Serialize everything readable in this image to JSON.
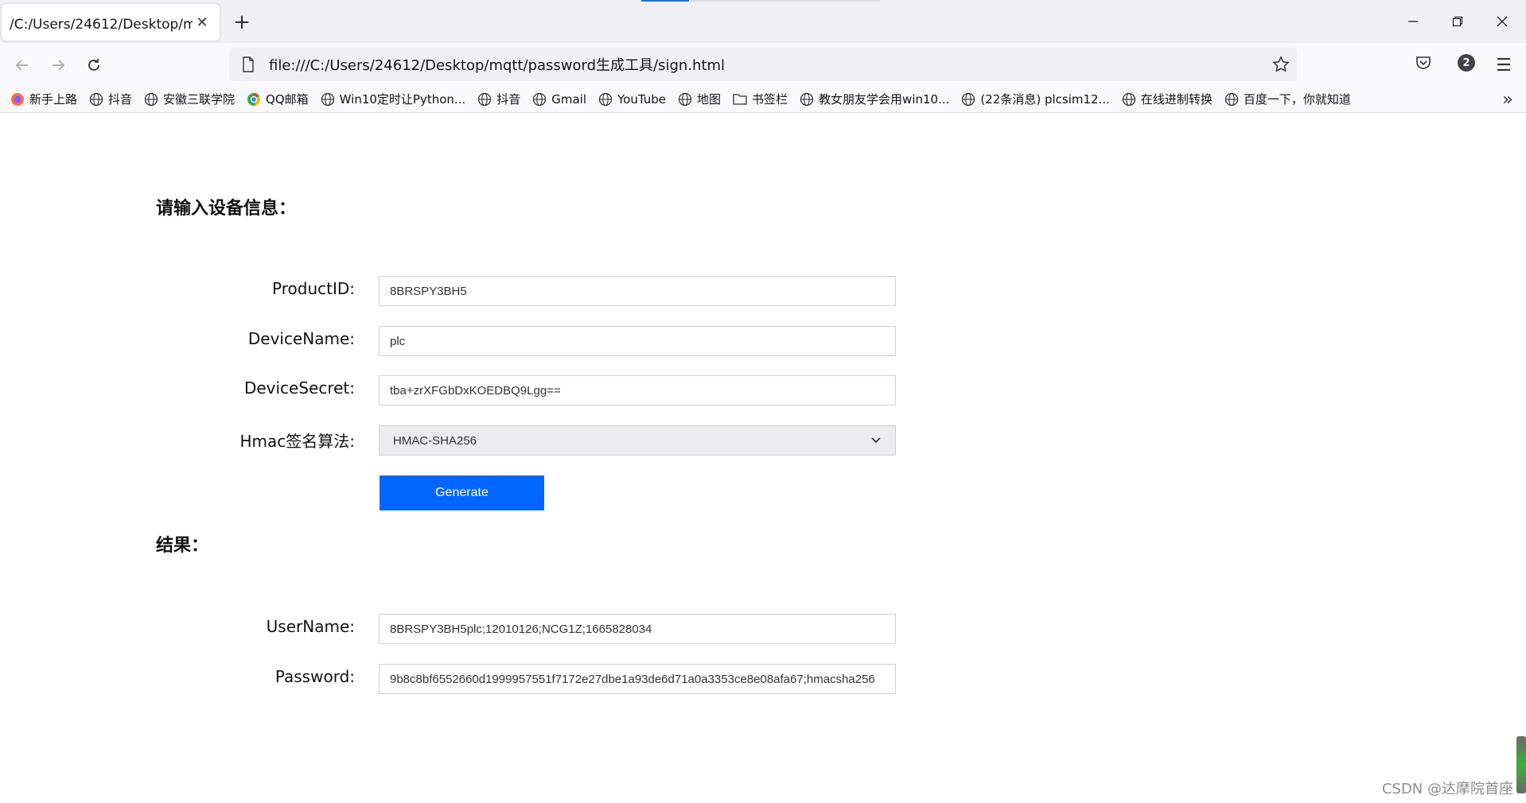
{
  "browser": {
    "tab_title": "/C:/Users/24612/Desktop/mqtt/password生成工具/sign.html",
    "url": "file:///C:/Users/24612/Desktop/mqtt/password生成工具/sign.html",
    "notification_count": "2",
    "bookmarks": [
      {
        "label": "新手上路",
        "icon": "firefox-icon"
      },
      {
        "label": "抖音",
        "icon": "globe-icon"
      },
      {
        "label": "安徽三联学院",
        "icon": "globe-icon"
      },
      {
        "label": "QQ邮箱",
        "icon": "chrome-icon"
      },
      {
        "label": "Win10定时让Python...",
        "icon": "globe-icon"
      },
      {
        "label": "抖音",
        "icon": "globe-icon"
      },
      {
        "label": "Gmail",
        "icon": "globe-icon"
      },
      {
        "label": "YouTube",
        "icon": "globe-icon"
      },
      {
        "label": "地图",
        "icon": "globe-icon"
      },
      {
        "label": "书签栏",
        "icon": "folder-icon"
      },
      {
        "label": "教女朋友学会用win10...",
        "icon": "globe-icon"
      },
      {
        "label": "(22条消息) plcsim12...",
        "icon": "globe-icon"
      },
      {
        "label": "在线进制转换",
        "icon": "globe-icon"
      },
      {
        "label": "百度一下，你就知道",
        "icon": "globe-icon"
      }
    ]
  },
  "form": {
    "heading": "请输入设备信息：",
    "product_id_label": "ProductID:",
    "product_id_value": "8BRSPY3BH5",
    "device_name_label": "DeviceName:",
    "device_name_value": "plc",
    "device_secret_label": "DeviceSecret:",
    "device_secret_value": "tba+zrXFGbDxKOEDBQ9Lgg==",
    "hmac_label": "Hmac签名算法:",
    "hmac_selected": "HMAC-SHA256",
    "generate_label": "Generate"
  },
  "result": {
    "heading": "结果：",
    "username_label": "UserName:",
    "username_value": "8BRSPY3BH5plc;12010126;NCG1Z;1665828034",
    "password_label": "Password:",
    "password_value": "9b8c8bf6552660d1999957551f7172e27dbe1a93de6d71a0a3353ce8e08afa67;hmacsha256"
  },
  "watermark": "CSDN @达摩院首座",
  "colors": {
    "accent": "#0066ff",
    "tab_strip": "#f0f0f4"
  }
}
